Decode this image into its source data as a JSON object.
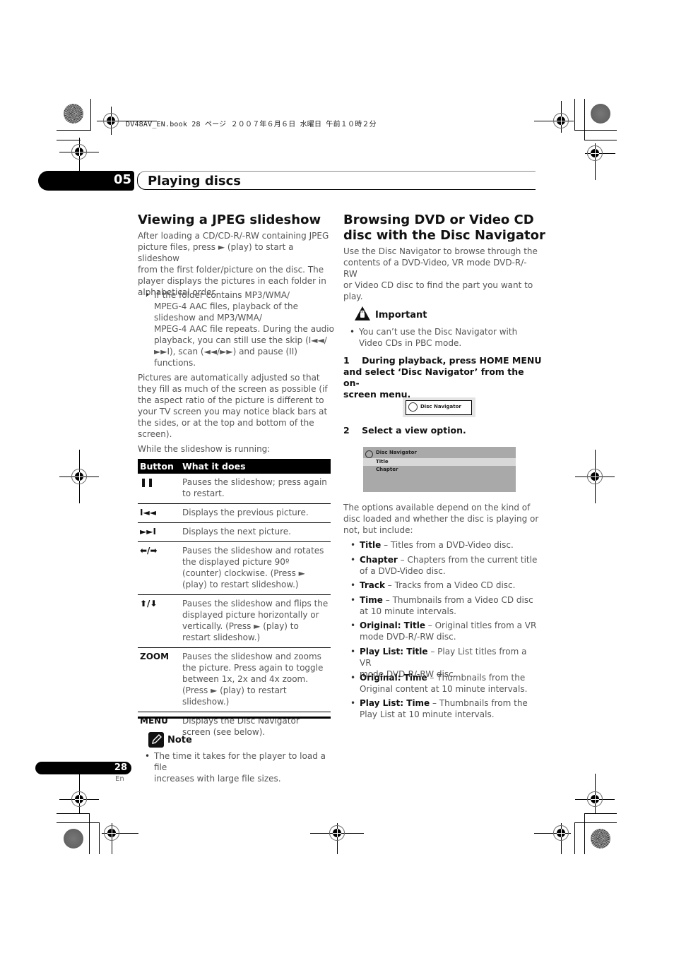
{
  "print_header": "DV48AV_EN.book  28 ページ  ２００７年６月６日  水曜日  午前１０時２分",
  "chapter": {
    "number": "05",
    "title": "Playing discs"
  },
  "left": {
    "heading": "Viewing a JPEG slideshow",
    "intro": [
      "After loading a CD/CD-R/-RW containing JPEG",
      "picture files, press ► (play) to start a slideshow",
      "from the first folder/picture on the disc. The",
      "player displays the pictures in each folder in",
      "alphabetical order."
    ],
    "bullet": [
      "If the folder contains MP3/WMA/",
      "MPEG-4 AAC files, playback of the",
      "slideshow and MP3/WMA/",
      "MPEG-4 AAC file repeats. During the audio",
      "playback, you can still use the skip (I◄◄/",
      "►►I), scan (◄◄/►►) and pause (II)",
      "functions."
    ],
    "para2": [
      "Pictures are automatically adjusted so that",
      "they fill as much of the screen as possible (if",
      "the aspect ratio of the picture is different to",
      "your TV screen you may notice black bars at",
      "the sides, or at the top and bottom of the",
      "screen)."
    ],
    "para3": "While the slideshow is running:",
    "table": {
      "headers": [
        "Button",
        "What it does"
      ],
      "rows": [
        {
          "key": "❚❚",
          "desc": "Pauses the slideshow; press again to restart."
        },
        {
          "key": "I◄◄",
          "desc": "Displays the previous picture."
        },
        {
          "key": "►►I",
          "desc": "Displays the next picture."
        },
        {
          "key": "⬅/➡",
          "desc": "Pauses the slideshow and rotates the displayed picture 90º (counter) clockwise. (Press ► (play) to restart slideshow.)"
        },
        {
          "key": "⬆/⬇",
          "desc": "Pauses the slideshow and flips the displayed picture horizontally or vertically. (Press ► (play) to restart slideshow.)"
        },
        {
          "key": "ZOOM",
          "desc": "Pauses the slideshow and zooms the picture. Press again to toggle between 1x, 2x and 4x zoom. (Press ► (play) to restart slideshow.)"
        },
        {
          "key": "MENU",
          "desc": "Displays the Disc Navigator screen (see below)."
        }
      ]
    },
    "note": {
      "label": "Note",
      "icon": "pencil-icon",
      "text": [
        "The time it takes for the player to load a file",
        "increases with large file sizes."
      ]
    }
  },
  "right": {
    "heading": [
      "Browsing DVD or Video CD",
      "disc with the Disc Navigator"
    ],
    "intro": [
      "Use the Disc Navigator to browse through the",
      "contents of a DVD-Video, VR mode DVD-R/-RW",
      "or Video CD disc to find the part you want to",
      "play."
    ],
    "important": {
      "label": "Important",
      "icon": "warning-hand-icon",
      "text": [
        "You can’t use the Disc Navigator with",
        "Video CDs in PBC mode."
      ]
    },
    "step1": [
      "1    During playback, press HOME MENU",
      "and select ‘Disc Navigator’ from the on-",
      "screen menu."
    ],
    "screen_small": {
      "label": "Disc Navigator"
    },
    "step2": "2    Select a view option.",
    "screen_big": {
      "title": "Disc Navigator",
      "items": [
        "Title",
        "Chapter"
      ],
      "selected": "Title"
    },
    "para": [
      "The options available depend on the kind of",
      "disc loaded and whether the disc is playing or",
      "not, but include:"
    ],
    "options": [
      {
        "term": "Title",
        "desc": [
          " – Titles from a DVD-Video disc."
        ]
      },
      {
        "term": "Chapter",
        "desc": [
          " – Chapters from the current title",
          "of a DVD-Video disc."
        ]
      },
      {
        "term": "Track",
        "desc": [
          " – Tracks from a Video CD disc."
        ]
      },
      {
        "term": "Time",
        "desc": [
          " – Thumbnails from a Video CD disc",
          "at 10 minute intervals."
        ]
      },
      {
        "term": "Original: Title",
        "desc": [
          " – Original titles from a VR",
          "mode DVD-R/-RW disc."
        ]
      },
      {
        "term": "Play List: Title",
        "desc": [
          " – Play List titles from a VR",
          "mode DVD-R/-RW disc."
        ]
      },
      {
        "term": "Original: Time",
        "desc": [
          " – Thumbnails from the",
          "Original content at 10 minute intervals."
        ]
      },
      {
        "term": "Play List: Time",
        "desc": [
          " – Thumbnails from the",
          "Play List at 10 minute intervals."
        ]
      }
    ]
  },
  "footer": {
    "page": "28",
    "lang": "En"
  }
}
